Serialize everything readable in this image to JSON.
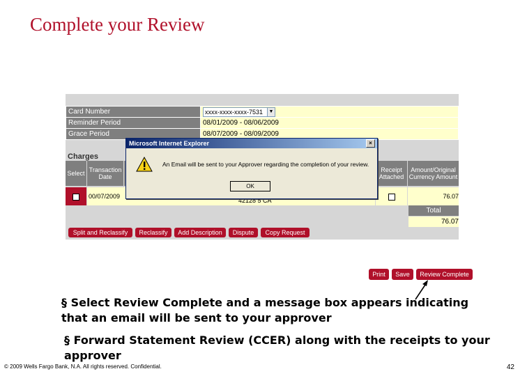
{
  "slide": {
    "title": "Complete your Review",
    "bullets": [
      "§ Select Review Complete and a message box appears indicating that an email will be sent to your approver",
      "§ Forward Statement Review (CCER) along with the receipts to your approver"
    ],
    "footer_left": "© 2009 Wells Fargo Bank, N.A. All rights reserved. Confidential.",
    "page_number": "42"
  },
  "form": {
    "card_label": "Card Number",
    "card_value": "xxxx-xxxx-xxxx-7531",
    "reminder_label": "Reminder Period",
    "reminder_value": "08/01/2009 - 08/06/2009",
    "grace_label": "Grace Period",
    "grace_value": "08/07/2009 - 08/09/2009"
  },
  "charges": {
    "title": "Charges",
    "headers": {
      "select": "Select",
      "transaction_date": "Transaction Date",
      "receipt_attached": "Receipt Attached",
      "amount": "Amount/Original Currency Amount"
    },
    "row": {
      "date": "00/07/2009",
      "ref": "42128 5 CA",
      "amount": "76.07"
    },
    "total_label": "Total",
    "total_value": "76.07",
    "buttons": [
      "Split and Reclassify",
      "Reclassify",
      "Add Description",
      "Dispute",
      "Copy Request"
    ]
  },
  "dialog": {
    "title": "Microsoft Internet Explorer",
    "message": "An Email will be sent to your Approver regarding the completion of your review.",
    "ok_label": "OK",
    "close": "×"
  },
  "actions": {
    "print": "Print",
    "save": "Save",
    "review_complete": "Review Complete"
  },
  "colors": {
    "brand_red": "#b0102a",
    "field_yellow": "#ffffcc",
    "label_gray": "#7f7f7f"
  },
  "icons": {
    "warning": "warning-icon",
    "dropdown": "chevron-down-icon",
    "close": "close-icon"
  }
}
